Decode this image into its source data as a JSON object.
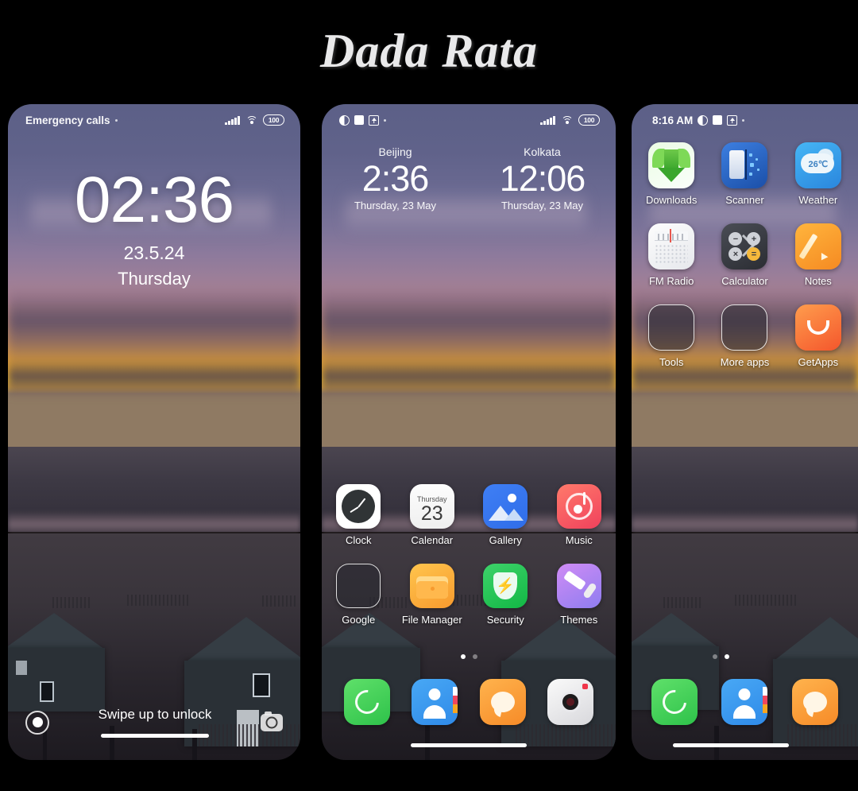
{
  "page": {
    "title": "Dada Rata"
  },
  "phone1": {
    "type": "lockscreen",
    "statusbar": {
      "emergency_label": "Emergency calls",
      "battery_level": "100",
      "icons": [
        "signal-icon",
        "wifi-icon",
        "battery-icon"
      ]
    },
    "clock": {
      "time": "02:36",
      "date": "23.5.24",
      "weekday": "Thursday"
    },
    "bottom": {
      "swipe_hint": "Swipe up to unlock",
      "left_icon": "flashlight-icon",
      "right_icon": "camera-icon"
    }
  },
  "phone2": {
    "type": "homescreen",
    "statusbar": {
      "battery_level": "100",
      "icons": [
        "dnd-icon",
        "square-icon",
        "upload-icon",
        "dot-icon",
        "signal-icon",
        "wifi-icon",
        "battery-icon"
      ]
    },
    "world_clock": [
      {
        "city": "Beijing",
        "time": "2:36",
        "date": "Thursday, 23 May"
      },
      {
        "city": "Kolkata",
        "time": "12:06",
        "date": "Thursday, 23 May"
      }
    ],
    "apps": [
      [
        {
          "label": "Clock",
          "icon": "clock-icon"
        },
        {
          "label": "Calendar",
          "icon": "calendar-icon",
          "weekday": "Thursday",
          "day": "23"
        },
        {
          "label": "Gallery",
          "icon": "gallery-icon"
        },
        {
          "label": "Music",
          "icon": "music-icon"
        }
      ],
      [
        {
          "label": "Google",
          "icon": "google-folder-icon"
        },
        {
          "label": "File Manager",
          "icon": "file-manager-icon"
        },
        {
          "label": "Security",
          "icon": "security-icon"
        },
        {
          "label": "Themes",
          "icon": "themes-icon"
        }
      ]
    ],
    "page_dots": {
      "count": 2,
      "active": 1
    },
    "dock": [
      {
        "label": "Phone",
        "icon": "phone-icon"
      },
      {
        "label": "Contacts",
        "icon": "contacts-icon"
      },
      {
        "label": "Messages",
        "icon": "messages-icon"
      },
      {
        "label": "Camera",
        "icon": "camera-icon"
      }
    ]
  },
  "phone3": {
    "type": "homescreen",
    "statusbar": {
      "time": "8:16 AM",
      "icons": [
        "dnd-icon",
        "square-icon",
        "upload-icon",
        "dot-icon"
      ]
    },
    "apps": [
      [
        {
          "label": "Downloads",
          "icon": "downloads-icon"
        },
        {
          "label": "Scanner",
          "icon": "scanner-icon"
        },
        {
          "label": "Weather",
          "icon": "weather-icon",
          "temperature": "26℃"
        }
      ],
      [
        {
          "label": "FM Radio",
          "icon": "fm-radio-icon"
        },
        {
          "label": "Calculator",
          "icon": "calculator-icon"
        },
        {
          "label": "Notes",
          "icon": "notes-icon"
        }
      ],
      [
        {
          "label": "Tools",
          "icon": "tools-folder-icon"
        },
        {
          "label": "More apps",
          "icon": "more-apps-folder-icon"
        },
        {
          "label": "GetApps",
          "icon": "getapps-icon"
        }
      ]
    ],
    "page_dots": {
      "count": 2,
      "active": 2
    },
    "dock": [
      {
        "label": "Phone",
        "icon": "phone-icon"
      },
      {
        "label": "Contacts",
        "icon": "contacts-icon"
      },
      {
        "label": "Messages",
        "icon": "messages-icon"
      }
    ]
  },
  "colors": {
    "background": "#000000",
    "title_text": "#e9e9ea",
    "accent_green": "#2ec24a",
    "accent_orange": "#f68b28",
    "accent_blue": "#2f8ae8"
  }
}
